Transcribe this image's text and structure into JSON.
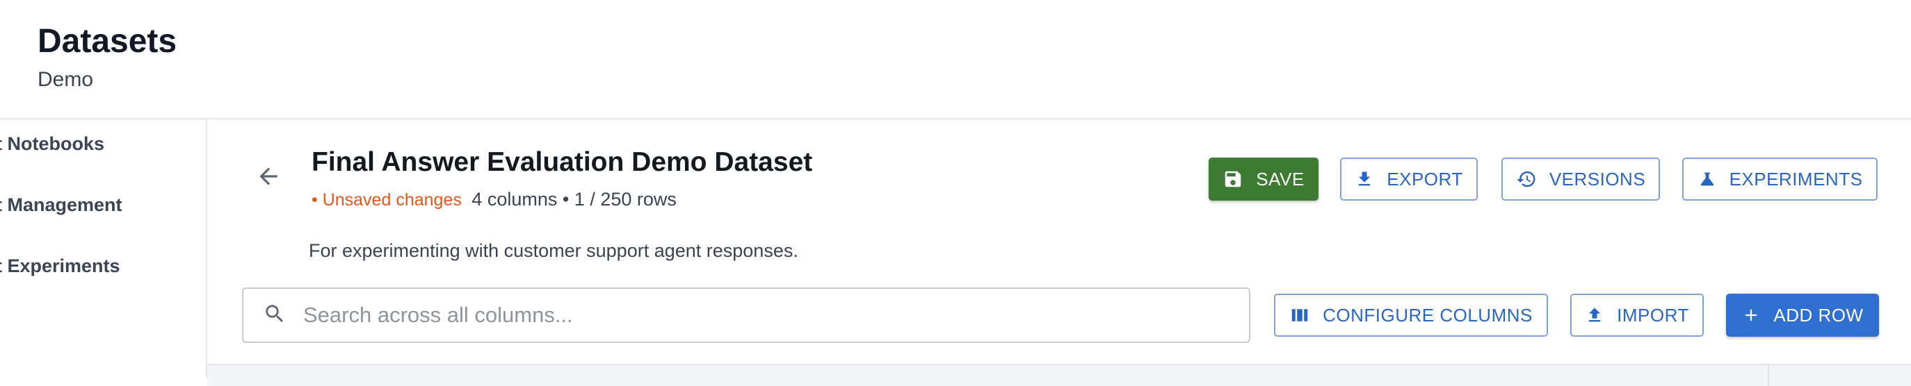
{
  "header": {
    "title": "Datasets",
    "subtitle": "Demo"
  },
  "sidebar": {
    "items": [
      {
        "label": "t Notebooks"
      },
      {
        "label": "t Management"
      },
      {
        "label": "t Experiments"
      }
    ]
  },
  "dataset": {
    "title": "Final Answer Evaluation Demo Dataset",
    "unsaved": "• Unsaved changes",
    "meta": "4 columns • 1 / 250 rows",
    "description": "For experimenting with customer support agent responses."
  },
  "toolbar": {
    "save_label": "SAVE",
    "export_label": "EXPORT",
    "versions_label": "VERSIONS",
    "experiments_label": "EXPERIMENTS",
    "configure_columns_label": "CONFIGURE COLUMNS",
    "import_label": "IMPORT",
    "add_row_label": "ADD ROW"
  },
  "search": {
    "placeholder": "Search across all columns...",
    "value": ""
  },
  "colors": {
    "save": "#3d7b33",
    "primary": "#2e6fd0",
    "warning": "#e4561b"
  },
  "icons": {
    "back": "arrow-left-icon",
    "save": "floppy-disk-icon",
    "export": "download-icon",
    "versions": "history-icon",
    "experiments": "flask-icon",
    "columns": "columns-icon",
    "import": "upload-icon",
    "add": "plus-icon",
    "search": "search-icon"
  }
}
